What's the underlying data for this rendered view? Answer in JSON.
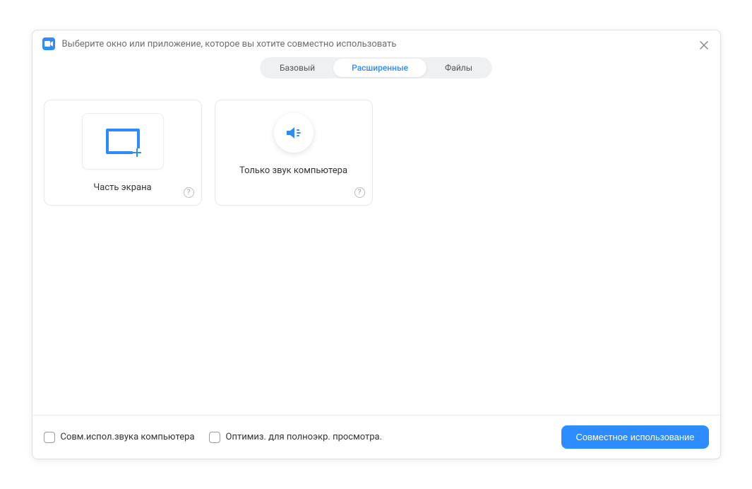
{
  "dialog": {
    "title": "Выберите окно или приложение, которое вы хотите совместно использовать"
  },
  "tabs": {
    "basic": "Базовый",
    "advanced": "Расширенные",
    "files": "Файлы",
    "active": "advanced"
  },
  "options": {
    "screen_portion": {
      "label": "Часть экрана"
    },
    "computer_audio": {
      "label": "Только звук компьютера"
    }
  },
  "footer": {
    "share_audio": "Совм.испол.звука компьютера",
    "optimize_video": "Оптимиз. для полноэкр. просмотра.",
    "share_button": "Совместное использование"
  },
  "help_glyph": "?"
}
